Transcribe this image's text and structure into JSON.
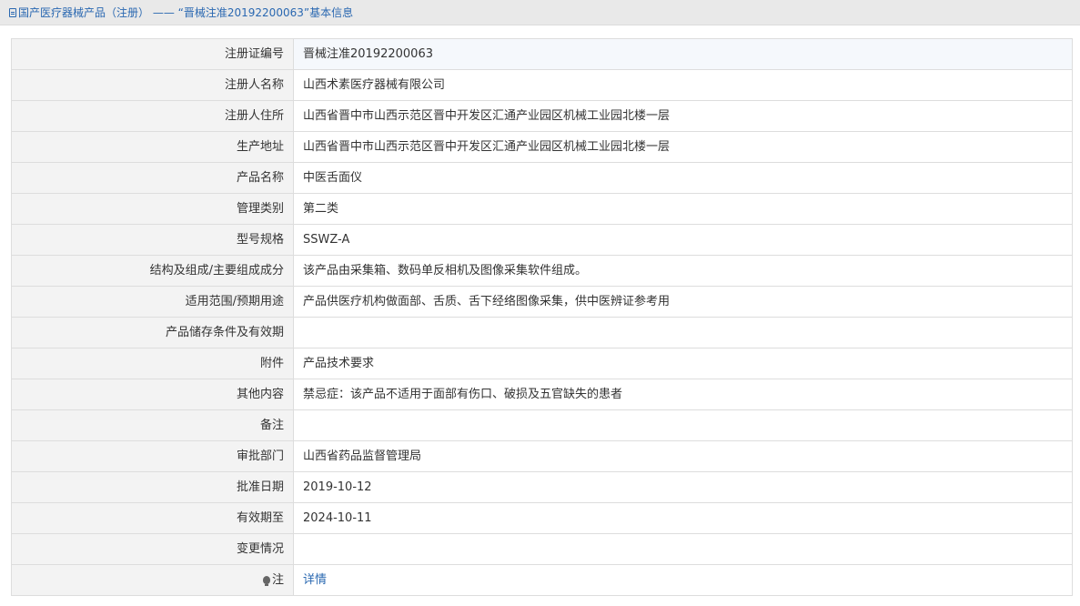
{
  "breadcrumb": {
    "icon": "document-icon",
    "category": "国产医疗器械产品（注册）",
    "separator": " —— ",
    "record_title": "“晋械注准20192200063”基本信息"
  },
  "rows": [
    {
      "label": "注册证编号",
      "value": "晋械注准20192200063"
    },
    {
      "label": "注册人名称",
      "value": "山西术素医疗器械有限公司"
    },
    {
      "label": "注册人住所",
      "value": "山西省晋中市山西示范区晋中开发区汇通产业园区机械工业园北楼一层"
    },
    {
      "label": "生产地址",
      "value": "山西省晋中市山西示范区晋中开发区汇通产业园区机械工业园北楼一层"
    },
    {
      "label": "产品名称",
      "value": "中医舌面仪"
    },
    {
      "label": "管理类别",
      "value": "第二类"
    },
    {
      "label": "型号规格",
      "value": "SSWZ-A"
    },
    {
      "label": "结构及组成/主要组成成分",
      "value": "该产品由采集箱、数码单反相机及图像采集软件组成。"
    },
    {
      "label": "适用范围/预期用途",
      "value": "产品供医疗机构做面部、舌质、舌下经络图像采集，供中医辨证参考用"
    },
    {
      "label": "产品储存条件及有效期",
      "value": ""
    },
    {
      "label": "附件",
      "value": "产品技术要求"
    },
    {
      "label": "其他内容",
      "value": "禁忌症：该产品不适用于面部有伤口、破损及五官缺失的患者"
    },
    {
      "label": "备注",
      "value": ""
    },
    {
      "label": "审批部门",
      "value": "山西省药品监督管理局"
    },
    {
      "label": "批准日期",
      "value": "2019-10-12"
    },
    {
      "label": "有效期至",
      "value": "2024-10-11"
    },
    {
      "label": "变更情况",
      "value": ""
    }
  ],
  "note_row": {
    "icon": "lightbulb-icon",
    "label": "注",
    "link": "详情"
  },
  "colors": {
    "link": "#2a68b1",
    "label_bg": "#f3f3f3",
    "border": "#dddddd",
    "header_bg": "#e9e9e9"
  }
}
